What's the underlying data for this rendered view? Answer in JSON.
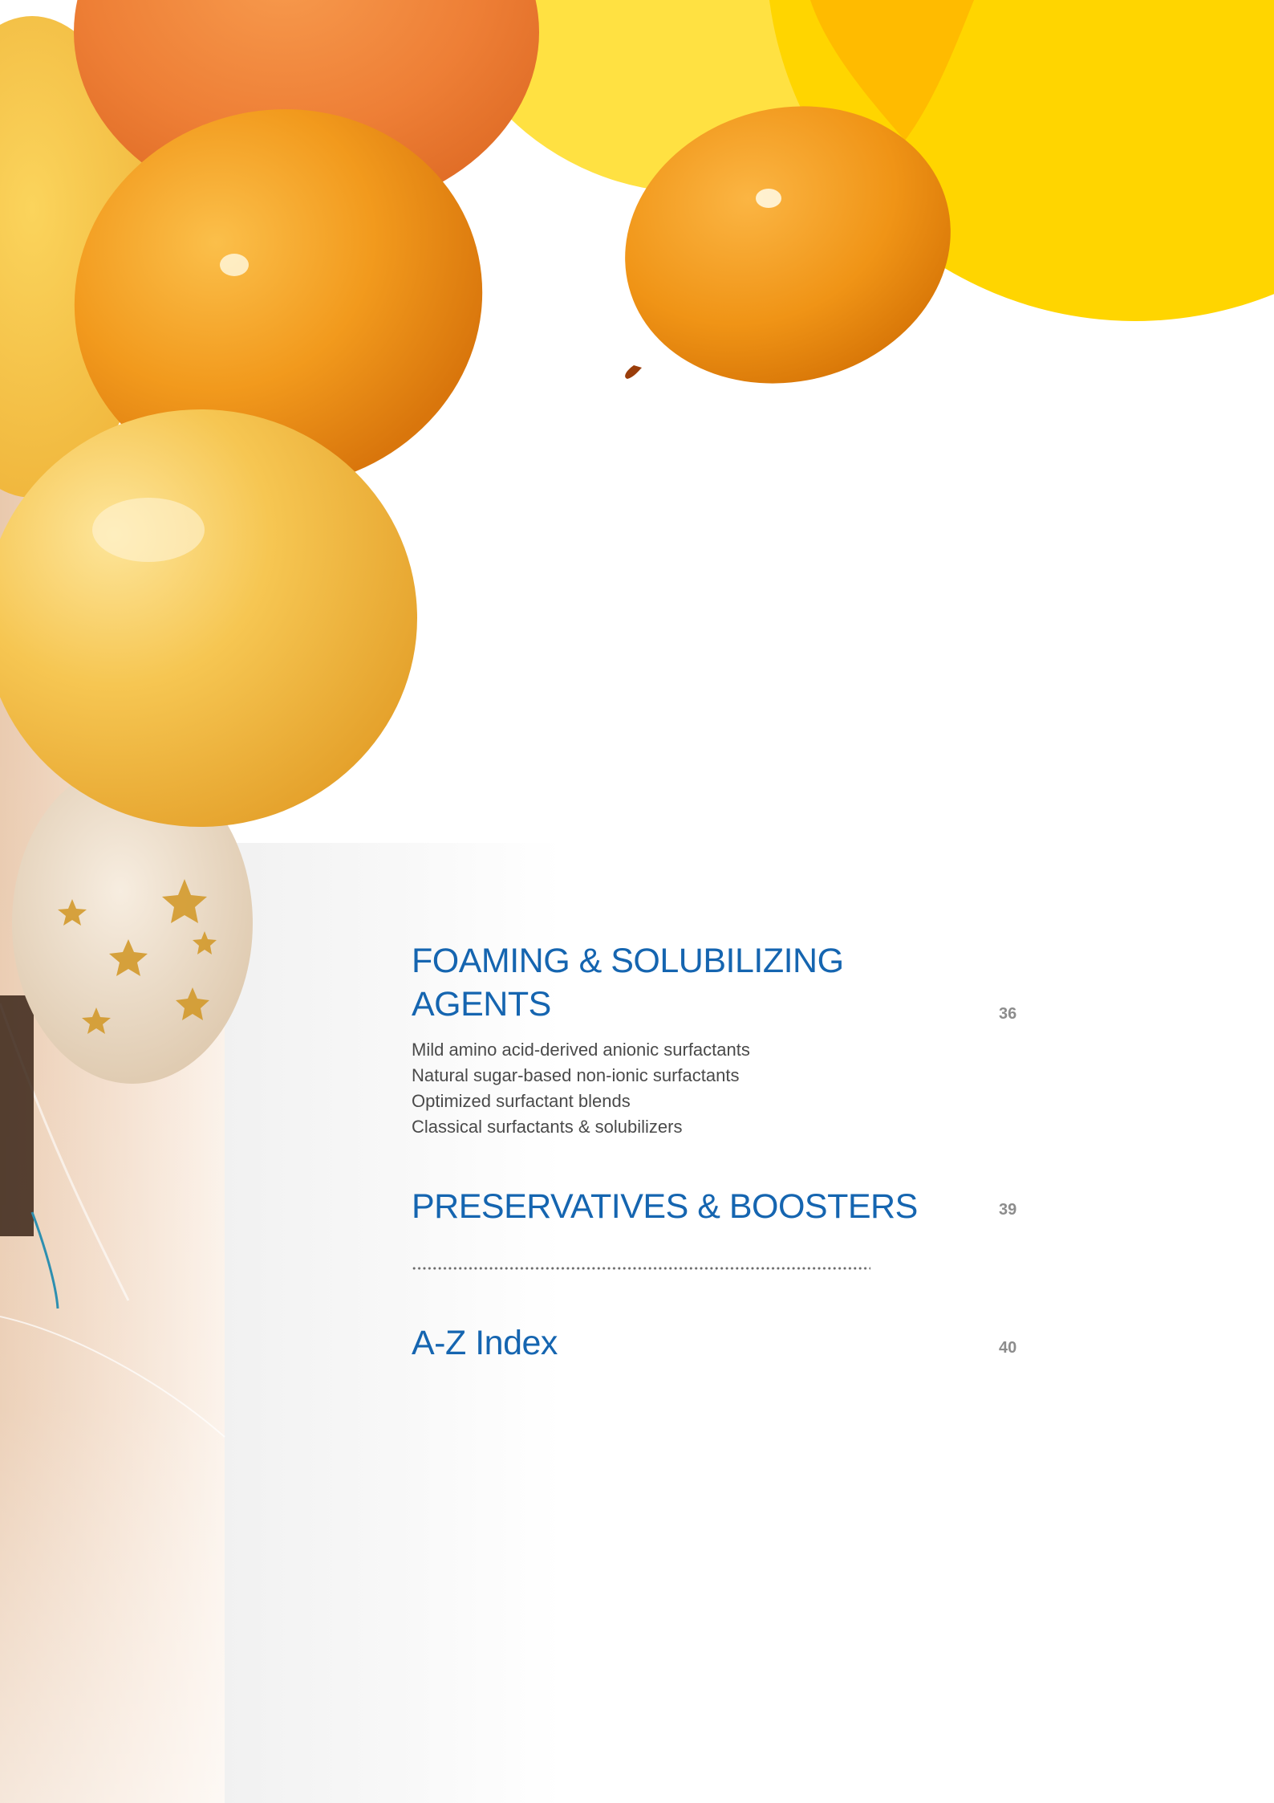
{
  "colors": {
    "heading_blue": "#1565b0",
    "page_number_grey": "#8c8c8c",
    "body_text": "#4a4a4a",
    "accent_yellow": "#ffd500",
    "balloon_orange": "#f0921a"
  },
  "toc": {
    "sections": [
      {
        "title_line_1": "FOAMING & SOLUBILIZING",
        "title_line_2": "AGENTS",
        "page": "36",
        "items": [
          "Mild amino acid-derived anionic surfactants",
          "Natural sugar-based non-ionic surfactants",
          "Optimized surfactant blends",
          "Classical surfactants & solubilizers"
        ]
      },
      {
        "title": "PRESERVATIVES & BOOSTERS",
        "page": "39"
      },
      {
        "title": "A-Z Index",
        "page": "40"
      }
    ]
  }
}
